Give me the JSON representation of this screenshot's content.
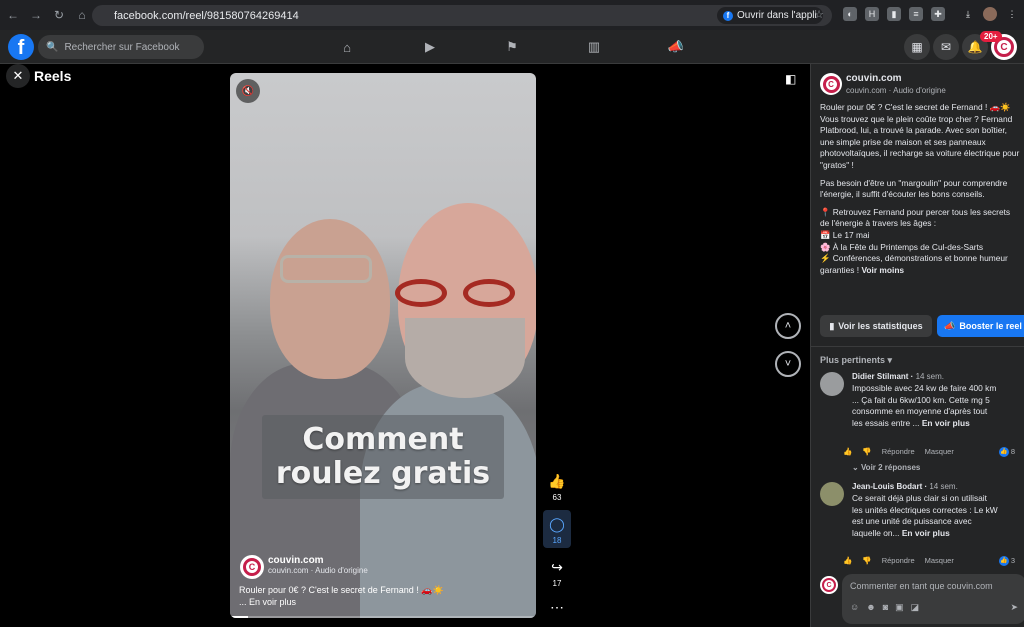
{
  "browser": {
    "url": "facebook.com/reel/981580764269414",
    "open_app_label": "Ouvrir dans l'appli"
  },
  "facebook": {
    "search_placeholder": "Rechercher sur Facebook",
    "notification_badge": "20+"
  },
  "reels": {
    "title": "Reels"
  },
  "video": {
    "overlay_text": "Comment\nroulez gratis",
    "author_name": "couvin.com",
    "audio": "couvin.com · Audio d'origine",
    "description": "Rouler pour 0€ ? C'est le secret de Fernand ! 🚗☀️",
    "see_more": "... En voir plus",
    "progress": 0.06
  },
  "actions": {
    "likes": "63",
    "comments": "18",
    "shares": "17"
  },
  "panel": {
    "author_name": "couvin.com",
    "audio": "couvin.com · Audio d'origine",
    "post_p1": "Rouler pour 0€ ? C'est le secret de Fernand ! 🚗☀️",
    "post_p2": "Vous trouvez que le plein coûte trop cher ? Fernand Platbrood, lui, a trouvé la parade. Avec son boîtier, une simple prise de maison et ses panneaux photovoltaïques, il recharge sa voiture électrique pour \"gratos\" !",
    "post_p3": "Pas besoin d'être un \"margoulin\" pour comprendre l'énergie, il suffit d'écouter les bons conseils.",
    "post_p4_l1": "📍 Retrouvez Fernand pour percer tous les secrets de l'énergie à travers les âges :",
    "post_p4_l2": "📅 Le 17 mai",
    "post_p4_l3": "🌸 À la Fête du Printemps de Cul-des-Sarts",
    "post_p4_l4": "⚡ Conférences, démonstrations et bonne humeur garanties !",
    "see_less": "Voir moins",
    "stats_button": "Voir les statistiques",
    "boost_button": "Booster le reel",
    "sort_label": "Plus pertinents"
  },
  "comments": [
    {
      "name": "Didier Stilmant",
      "time": "14 sem.",
      "text": "Impossible avec 24 kw de faire 400 km ... Ça fait du 6kw/100 km. Cette mg 5 consomme en moyenne d'après tout les essais entre ...",
      "see_more": "En voir plus",
      "reply": "Répondre",
      "hide": "Masquer",
      "reactions": "8",
      "replies_link": "Voir 2 réponses"
    },
    {
      "name": "Jean-Louis Bodart",
      "time": "14 sem.",
      "text": "Ce serait déjà plus clair si on utilisait les unités électriques correctes : Le kW est une unité de puissance avec laquelle on...",
      "see_more": "En voir plus",
      "reply": "Répondre",
      "hide": "Masquer",
      "reactions": "3"
    }
  ],
  "composer": {
    "placeholder": "Commenter en tant que couvin.com"
  },
  "colors": {
    "facebook_blue": "#1877f2",
    "brand_red": "#c51f4b",
    "panel_bg": "#242526"
  }
}
